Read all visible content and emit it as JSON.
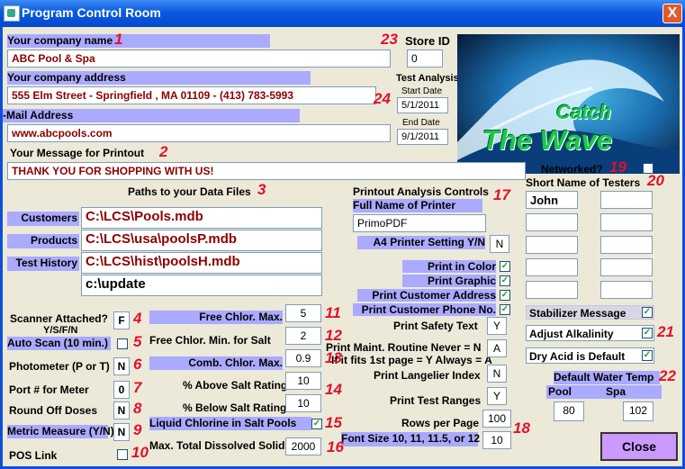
{
  "window": {
    "title": "Program Control Room",
    "close_glyph": "X"
  },
  "company": {
    "name_label": "Your company name",
    "name_value": "ABC Pool & Spa",
    "address_label": "Your company address",
    "address_value": "555 Elm Street - Springfield , MA 01109 - (413) 783-5993",
    "email_label": "-Mail Address",
    "email_value": "www.abcpools.com"
  },
  "store": {
    "label": "Store ID",
    "value": "0"
  },
  "test_analysis": {
    "label": "Test Analysis",
    "start_label": "Start Date",
    "start_value": "5/1/2011",
    "end_label": "End Date",
    "end_value": "9/1/2011"
  },
  "logo": {
    "line1": "Catch",
    "line2": "The Wave"
  },
  "message": {
    "label": "Your Message for Printout",
    "value": "THANK YOU FOR SHOPPING WITH US!"
  },
  "networked": {
    "label": "Networked?",
    "checked": false
  },
  "paths": {
    "heading": "Paths to your Data Files",
    "customers_label": "Customers",
    "customers_value": "C:\\LCS\\Pools.mdb",
    "products_label": "Products",
    "products_value": "C:\\LCS\\usa\\poolsP.mdb",
    "history_label": "Test History",
    "history_value": "C:\\LCS\\hist\\poolsH.mdb",
    "update_value": "c:\\update"
  },
  "printout": {
    "heading": "Printout Analysis Controls",
    "printer_label": "Full Name of Printer",
    "printer_value": "PrimoPDF",
    "a4_label": "A4 Printer Setting Y/N",
    "a4_value": "N",
    "color_label": "Print in Color",
    "graphic_label": "Print Graphic",
    "address_label": "Print Customer Address",
    "phone_label": "Print Customer Phone No.",
    "safety_label": "Print Safety Text",
    "safety_value": "Y",
    "maint_line1": "Print  Maint.  Routine   Never = N",
    "maint_line2": "If it fits 1st page = Y Always = A",
    "maint_value": "A",
    "langelier_label": "Print Langelier Index",
    "langelier_value": "N",
    "ranges_label": "Print Test Ranges",
    "ranges_value": "Y",
    "rows_label": "Rows per Page",
    "rows_value": "100",
    "font_label": "Font Size 10, 11, 11.5, or 12",
    "font_value": "10"
  },
  "testers": {
    "heading": "Short Name of Testers",
    "first": "John"
  },
  "stabilizer": {
    "label": "Stabilizer Message"
  },
  "alkalinity": {
    "label": "Adjust Alkalinity"
  },
  "dry_acid": {
    "label": "Dry Acid is Default"
  },
  "water_temp": {
    "heading": "Default Water Temp",
    "pool_label": "Pool",
    "spa_label": "Spa",
    "pool_value": "80",
    "spa_value": "102"
  },
  "scanner": {
    "label_line1": "Scanner Attached?",
    "label_line2": "Y/S/F/N",
    "value": "F"
  },
  "auto_scan": {
    "label": "Auto Scan (10 min.)"
  },
  "photometer": {
    "label": "Photometer (P or T)",
    "value": "N"
  },
  "port": {
    "label": "Port # for Meter",
    "value": "0"
  },
  "round_off": {
    "label": "Round Off Doses",
    "value": "N"
  },
  "metric": {
    "label": "Metric Measure (Y/N)",
    "value": "N"
  },
  "pos": {
    "label": "POS Link"
  },
  "chlorine": {
    "free_max_label": "Free Chlor. Max.",
    "free_max_value": "5",
    "free_min_label": "Free Chlor. Min. for Salt",
    "free_min_value": "2",
    "comb_max_label": "Comb. Chlor. Max.",
    "comb_max_value": "0.9",
    "above_salt_label": "% Above Salt Rating",
    "above_salt_value": "10",
    "below_salt_label": "% Below Salt Rating",
    "below_salt_value": "10",
    "liquid_label": "Liquid Chlorine in Salt Pools",
    "tds_label": "Max. Total Dissolved Solids",
    "tds_value": "2000"
  },
  "close_button": {
    "label": "Close"
  },
  "markers": [
    "1",
    "2",
    "3",
    "4",
    "5",
    "6",
    "7",
    "8",
    "9",
    "10",
    "11",
    "12",
    "13",
    "14",
    "15",
    "16",
    "17",
    "18",
    "19",
    "20",
    "21",
    "22",
    "23",
    "24"
  ]
}
